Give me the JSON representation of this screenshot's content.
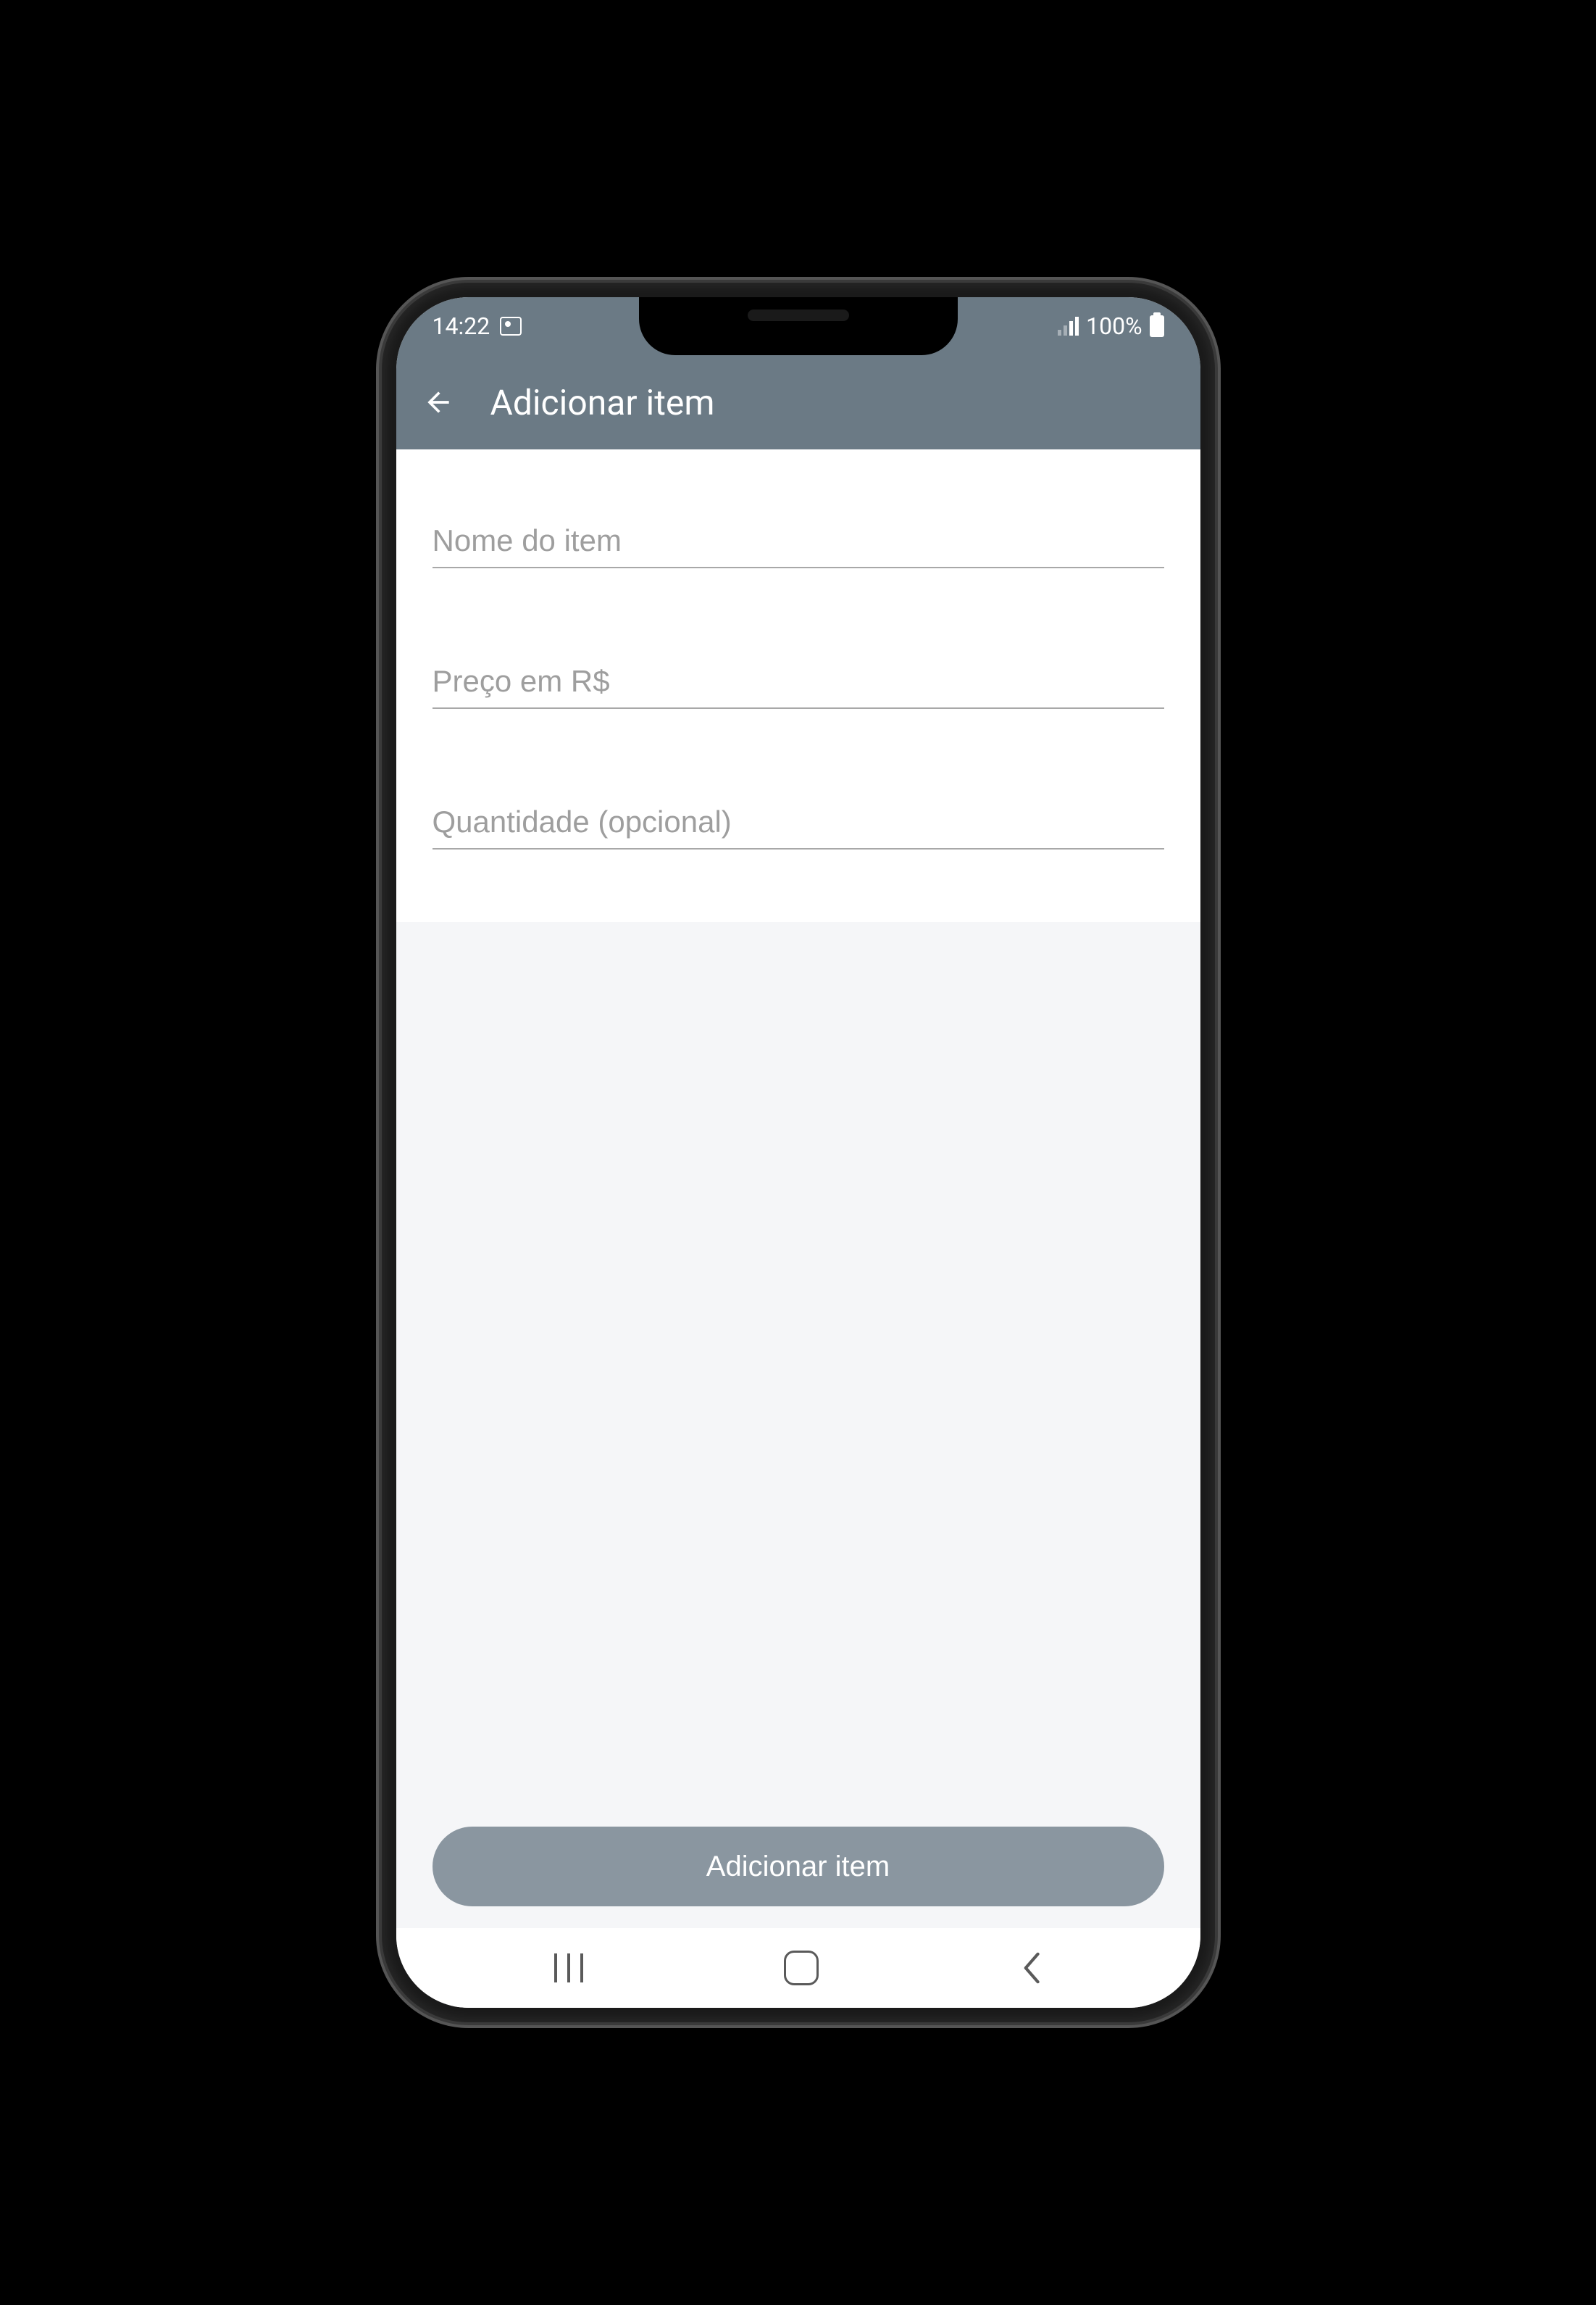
{
  "status": {
    "time": "14:22",
    "battery_text": "100%"
  },
  "header": {
    "title": "Adicionar item"
  },
  "form": {
    "item_name_placeholder": "Nome do item",
    "price_placeholder": "Preço em R$",
    "quantity_placeholder": "Quantidade (opcional)"
  },
  "action": {
    "add_label": "Adicionar item"
  }
}
